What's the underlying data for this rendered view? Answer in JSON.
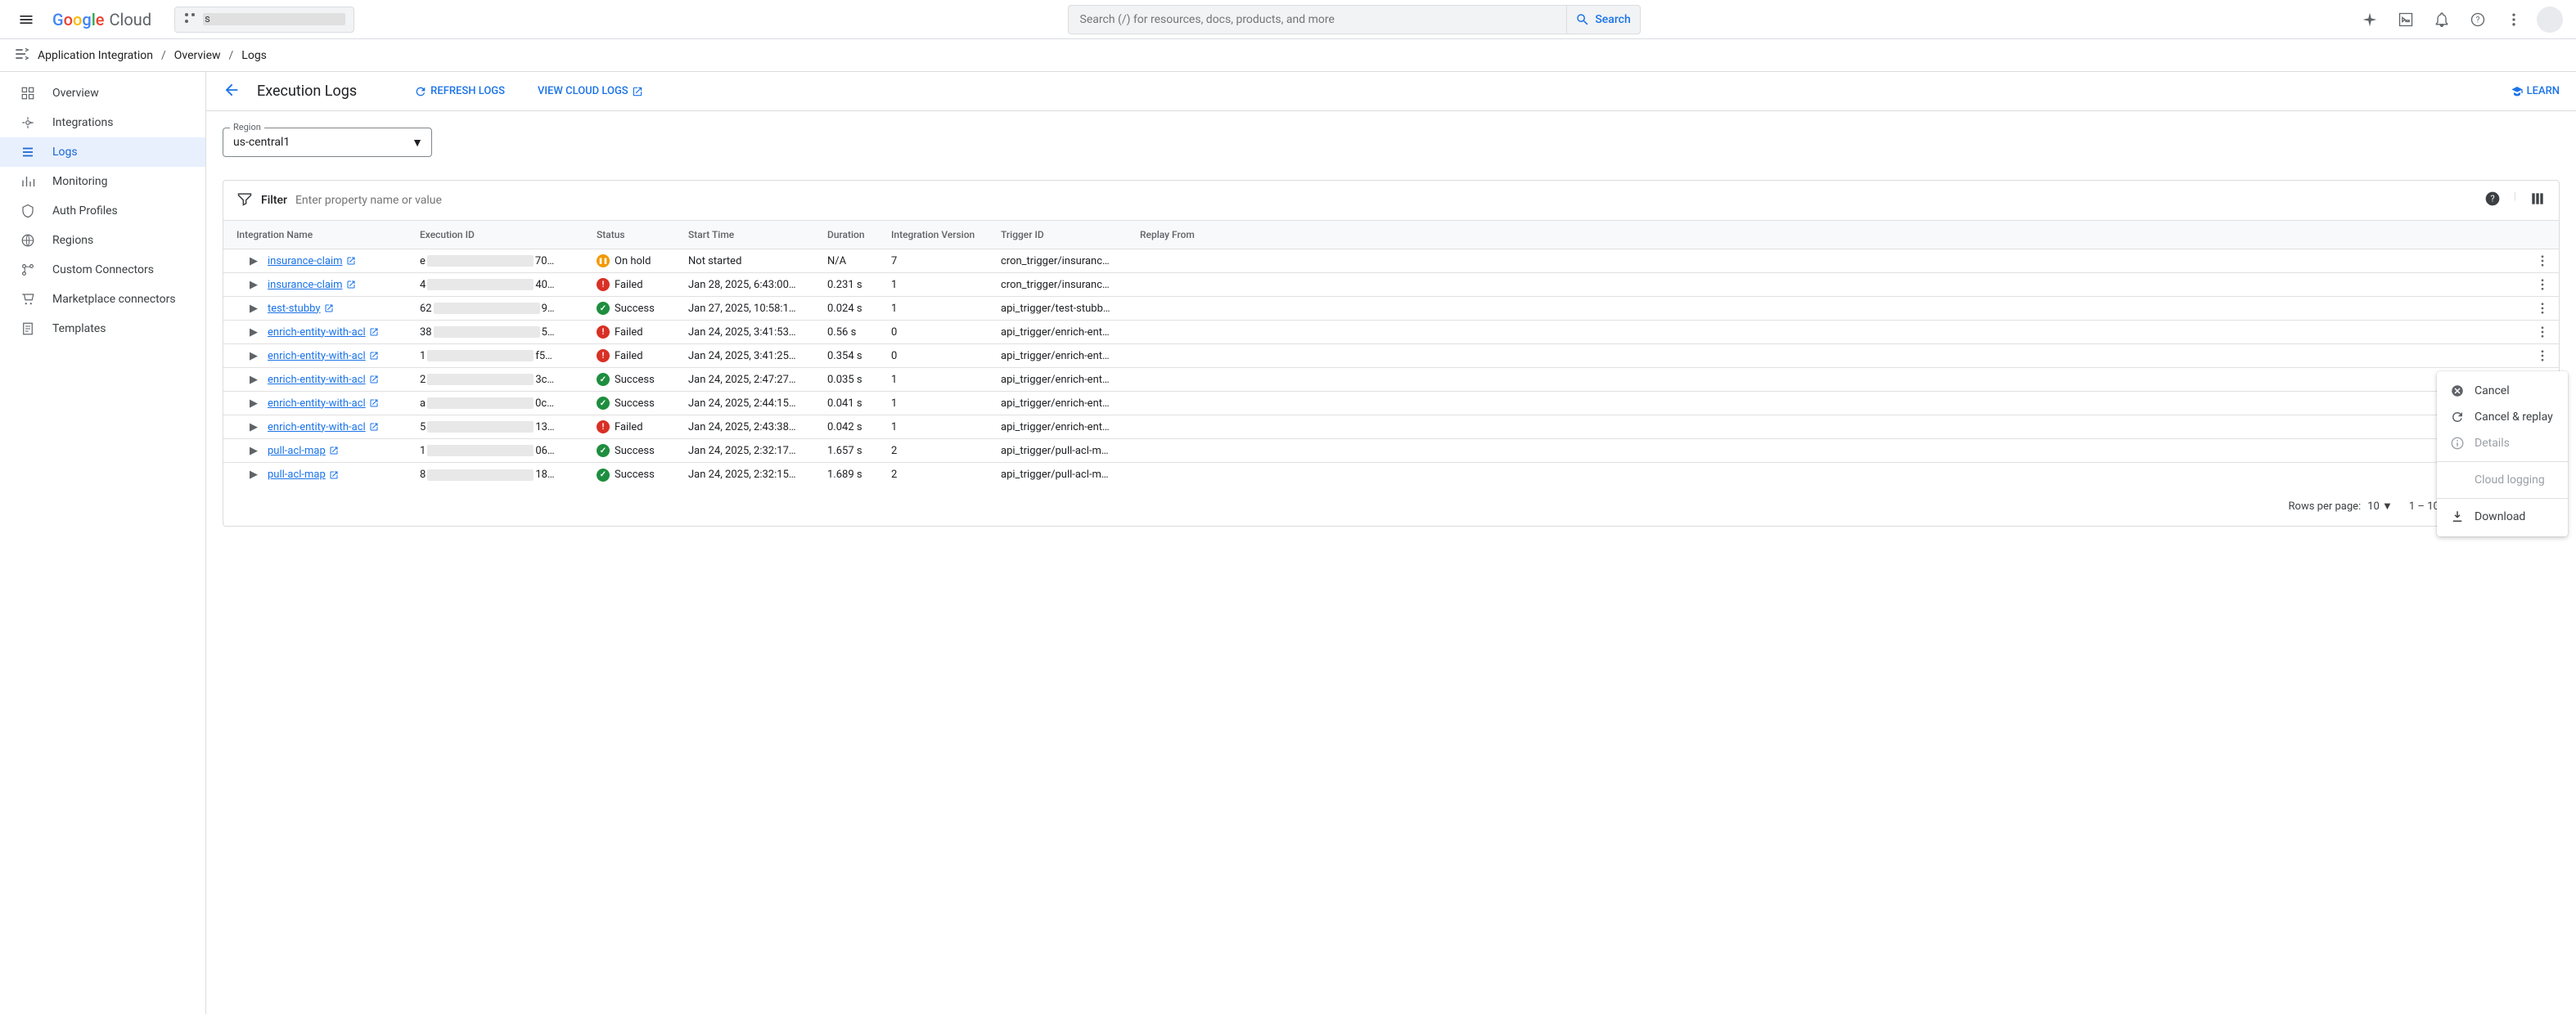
{
  "header": {
    "logo_text": "Google",
    "logo_cloud": "Cloud",
    "project_prefix": "s",
    "search_placeholder": "Search (/) for resources, docs, products, and more",
    "search_button": "Search"
  },
  "breadcrumb": {
    "product": "Application Integration",
    "overview": "Overview",
    "current": "Logs"
  },
  "sidebar": {
    "items": [
      {
        "label": "Overview"
      },
      {
        "label": "Integrations"
      },
      {
        "label": "Logs"
      },
      {
        "label": "Monitoring"
      },
      {
        "label": "Auth Profiles"
      },
      {
        "label": "Regions"
      },
      {
        "label": "Custom Connectors"
      },
      {
        "label": "Marketplace connectors"
      },
      {
        "label": "Templates"
      }
    ]
  },
  "page": {
    "title": "Execution Logs",
    "refresh": "REFRESH LOGS",
    "view_cloud": "VIEW CLOUD LOGS",
    "learn": "LEARN"
  },
  "region": {
    "label": "Region",
    "value": "us-central1"
  },
  "filter": {
    "label": "Filter",
    "placeholder": "Enter property name or value"
  },
  "columns": {
    "name": "Integration Name",
    "exec": "Execution ID",
    "status": "Status",
    "start": "Start Time",
    "dur": "Duration",
    "ver": "Integration Version",
    "trig": "Trigger ID",
    "replay": "Replay From"
  },
  "statuses": {
    "onhold": "On hold",
    "failed": "Failed",
    "success": "Success"
  },
  "rows": [
    {
      "name": "insurance-claim",
      "ep": "e",
      "es": "70…",
      "st": "onhold",
      "start": "Not started",
      "dur": "N/A",
      "ver": "7",
      "trig": "cron_trigger/insuranc…"
    },
    {
      "name": "insurance-claim",
      "ep": "4",
      "es": "40…",
      "st": "failed",
      "start": "Jan 28, 2025, 6:43:00…",
      "dur": "0.231 s",
      "ver": "1",
      "trig": "cron_trigger/insuranc…"
    },
    {
      "name": "test-stubby",
      "ep": "62",
      "es": "9…",
      "st": "success",
      "start": "Jan 27, 2025, 10:58:1…",
      "dur": "0.024 s",
      "ver": "1",
      "trig": "api_trigger/test-stubb…"
    },
    {
      "name": "enrich-entity-with-acl",
      "ep": "38",
      "es": "5…",
      "st": "failed",
      "start": "Jan 24, 2025, 3:41:53…",
      "dur": "0.56 s",
      "ver": "0",
      "trig": "api_trigger/enrich-ent…"
    },
    {
      "name": "enrich-entity-with-acl",
      "ep": "1",
      "es": "f5…",
      "st": "failed",
      "start": "Jan 24, 2025, 3:41:25…",
      "dur": "0.354 s",
      "ver": "0",
      "trig": "api_trigger/enrich-ent…"
    },
    {
      "name": "enrich-entity-with-acl",
      "ep": "2",
      "es": "3c…",
      "st": "success",
      "start": "Jan 24, 2025, 2:47:27…",
      "dur": "0.035 s",
      "ver": "1",
      "trig": "api_trigger/enrich-ent…"
    },
    {
      "name": "enrich-entity-with-acl",
      "ep": "a",
      "es": "0c…",
      "st": "success",
      "start": "Jan 24, 2025, 2:44:15…",
      "dur": "0.041 s",
      "ver": "1",
      "trig": "api_trigger/enrich-ent…"
    },
    {
      "name": "enrich-entity-with-acl",
      "ep": "5",
      "es": "13…",
      "st": "failed",
      "start": "Jan 24, 2025, 2:43:38…",
      "dur": "0.042 s",
      "ver": "1",
      "trig": "api_trigger/enrich-ent…"
    },
    {
      "name": "pull-acl-map",
      "ep": "1",
      "es": "06…",
      "st": "success",
      "start": "Jan 24, 2025, 2:32:17…",
      "dur": "1.657 s",
      "ver": "2",
      "trig": "api_trigger/pull-acl-m…"
    },
    {
      "name": "pull-acl-map",
      "ep": "8",
      "es": "18…",
      "st": "success",
      "start": "Jan 24, 2025, 2:32:15…",
      "dur": "1.689 s",
      "ver": "2",
      "trig": "api_trigger/pull-acl-m…"
    }
  ],
  "pagination": {
    "rpp_label": "Rows per page:",
    "rpp_value": "10",
    "range": "1 – 10 of many"
  },
  "context_menu": {
    "cancel": "Cancel",
    "cancel_replay": "Cancel & replay",
    "details": "Details",
    "cloud_logging": "Cloud logging",
    "download": "Download"
  }
}
